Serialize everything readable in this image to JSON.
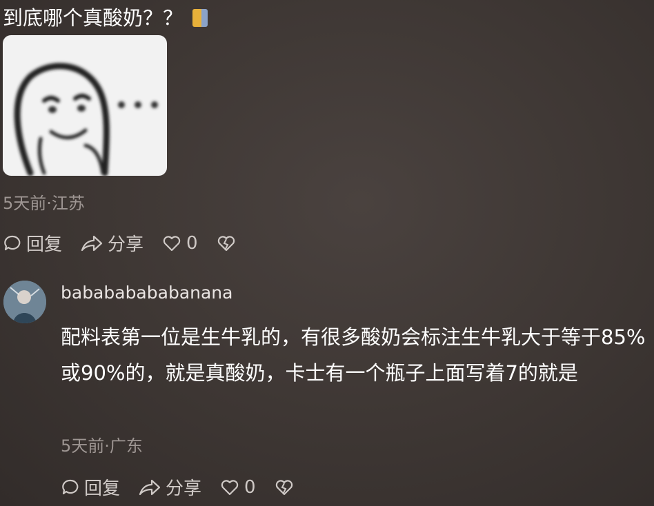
{
  "post": {
    "text": "到底哪个真酸奶？？",
    "emoji_icon": "cat-emoji-icon",
    "meta": "5天前·江苏",
    "actions": {
      "reply": "回复",
      "share": "分享",
      "likes": "0"
    }
  },
  "comment": {
    "username": "babababababanana",
    "text": "配料表第一位是生牛乳的，有很多酸奶会标注生牛乳大于等于85%或90%的，就是真酸奶，卡士有一个瓶子上面写着7的就是",
    "meta": "5天前·广东",
    "actions": {
      "reply": "回复",
      "share": "分享",
      "likes": "0"
    }
  },
  "colors": {
    "background": "#3d3633",
    "meta": "#9e9693",
    "action": "#cfc9c6"
  }
}
